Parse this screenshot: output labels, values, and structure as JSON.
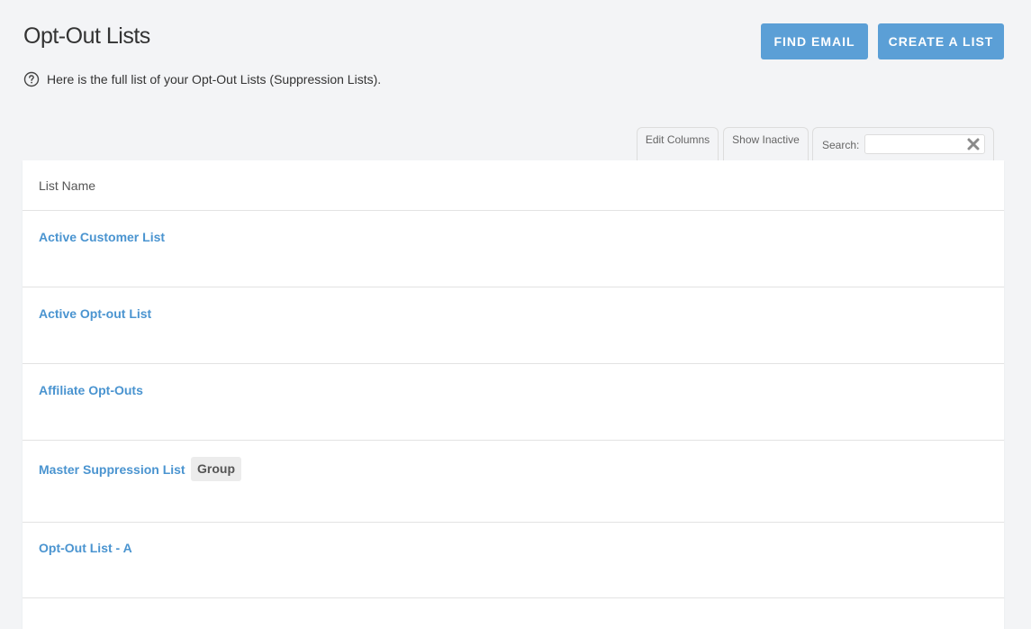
{
  "page": {
    "title": "Opt-Out Lists",
    "help_text": "Here is the full list of your Opt-Out Lists (Suppression Lists)."
  },
  "actions": {
    "find_email": "FIND EMAIL",
    "create_list": "CREATE A LIST"
  },
  "toolbar": {
    "edit_columns": "Edit Columns",
    "show_inactive": "Show Inactive",
    "search_label": "Search:",
    "search_value": ""
  },
  "table": {
    "columns": [
      "List Name"
    ],
    "rows": [
      {
        "name": "Active Customer List",
        "badge": ""
      },
      {
        "name": "Active Opt-out List",
        "badge": ""
      },
      {
        "name": "Affiliate Opt-Outs",
        "badge": ""
      },
      {
        "name": "Master Suppression List",
        "badge": "Group"
      },
      {
        "name": "Opt-Out List - A",
        "badge": ""
      }
    ]
  },
  "colors": {
    "accent": "#5b9fd6",
    "link": "#4a94d0",
    "background": "#f3f4f6"
  },
  "icons": {
    "help": "question-circle-icon",
    "clear": "close-x-icon"
  }
}
